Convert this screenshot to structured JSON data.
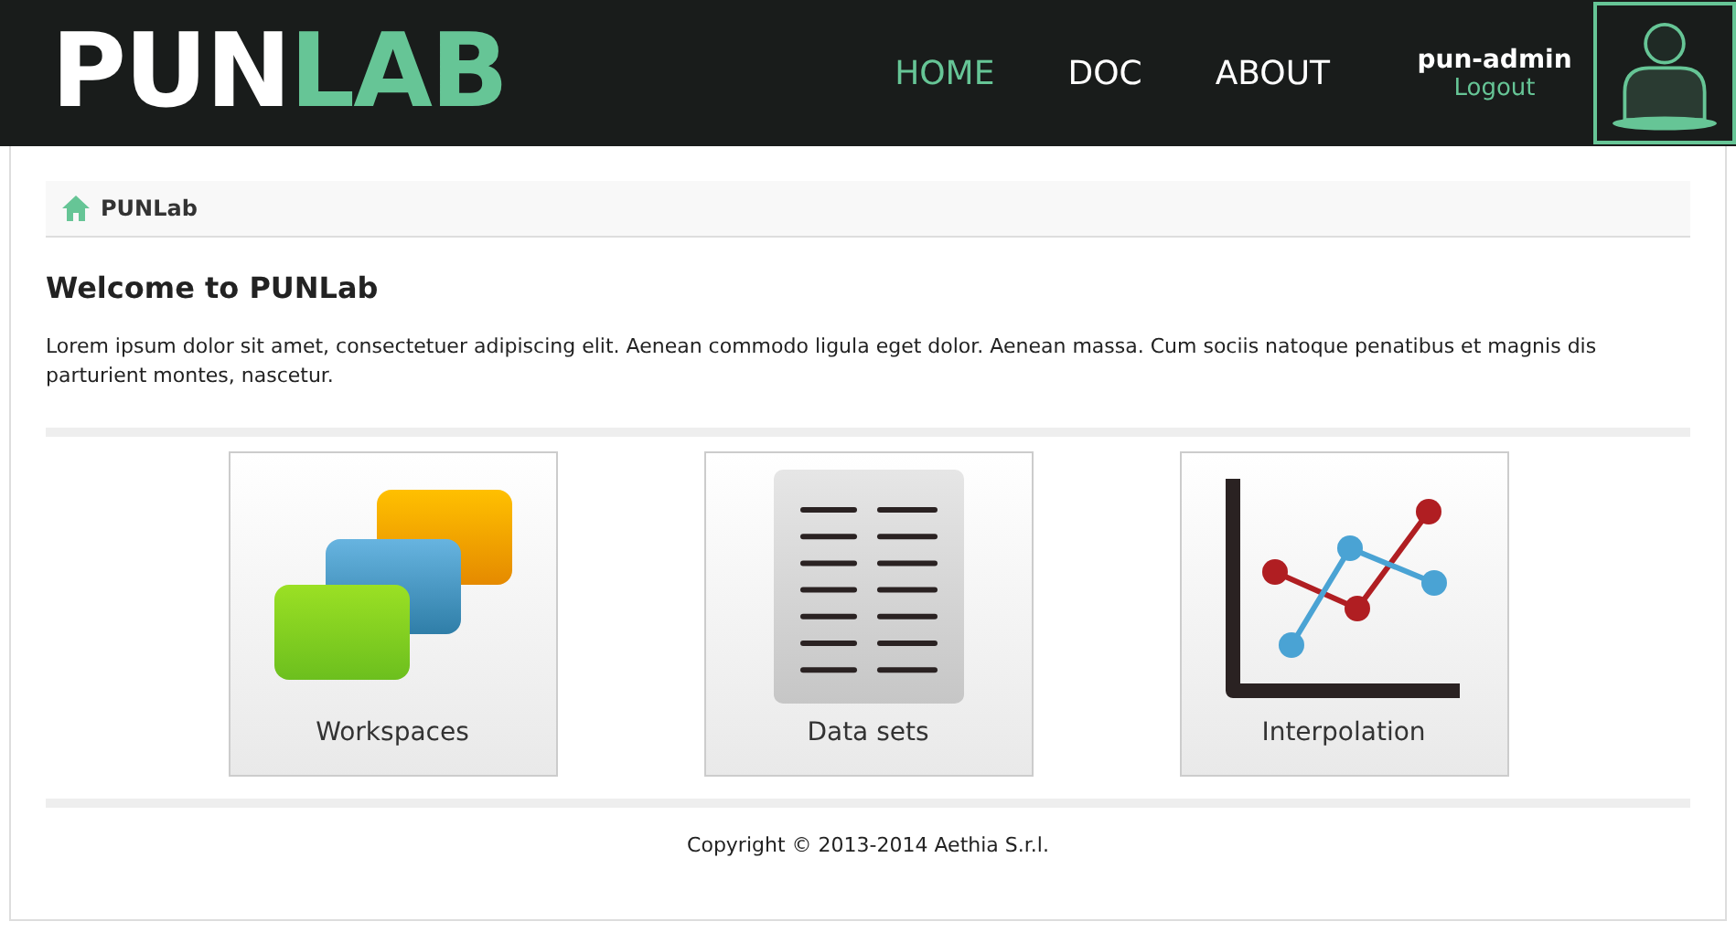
{
  "header": {
    "logo": [
      {
        "text": "PUN",
        "kind": "plain"
      },
      {
        "text": "LAB",
        "kind": "accent"
      }
    ],
    "nav": [
      {
        "label": "HOME",
        "selected": true
      },
      {
        "label": "DOC",
        "selected": false
      },
      {
        "label": "ABOUT",
        "selected": false
      }
    ],
    "user": {
      "name": "pun-admin",
      "logout": "Logout"
    }
  },
  "breadcrumb": {
    "label": "PUNLab"
  },
  "welcome": {
    "title": "Welcome to PUNLab",
    "text": "Lorem ipsum dolor sit amet, consectetuer adipiscing elit. Aenean commodo ligula eget dolor. Aenean massa. Cum sociis natoque penatibus et magnis dis parturient montes, nascetur."
  },
  "tiles": [
    {
      "label": "Workspaces",
      "kind": "workspaces"
    },
    {
      "label": "Data sets",
      "kind": "datasets"
    },
    {
      "label": "Interpolation",
      "kind": "chart"
    }
  ],
  "footer": {
    "copyright": "Copyright © 2013-2014 Aethia S.r.l."
  }
}
